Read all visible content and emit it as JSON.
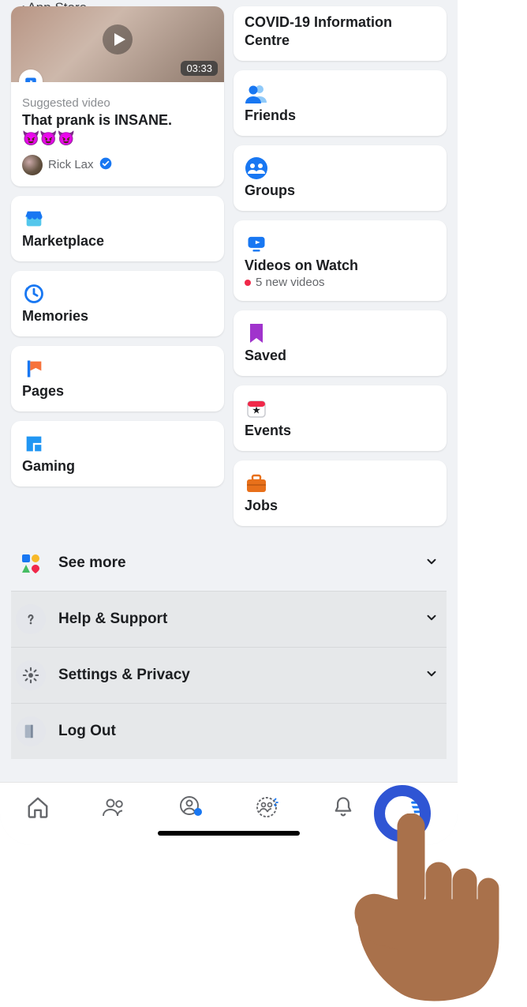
{
  "back": "App Store",
  "video": {
    "duration": "03:33",
    "suggested": "Suggested video",
    "title": "That prank is INSANE.",
    "emojis": "😈😈😈",
    "author": "Rick Lax"
  },
  "left": {
    "marketplace": "Marketplace",
    "memories": "Memories",
    "pages": "Pages",
    "gaming": "Gaming"
  },
  "right": {
    "covid": "COVID-19 Information Centre",
    "friends": "Friends",
    "groups": "Groups",
    "watch": "Videos on Watch",
    "watch_sub": "5 new videos",
    "saved": "Saved",
    "events": "Events",
    "jobs": "Jobs"
  },
  "rows": {
    "seemore": "See more",
    "help": "Help & Support",
    "settings": "Settings & Privacy",
    "logout": "Log Out"
  }
}
